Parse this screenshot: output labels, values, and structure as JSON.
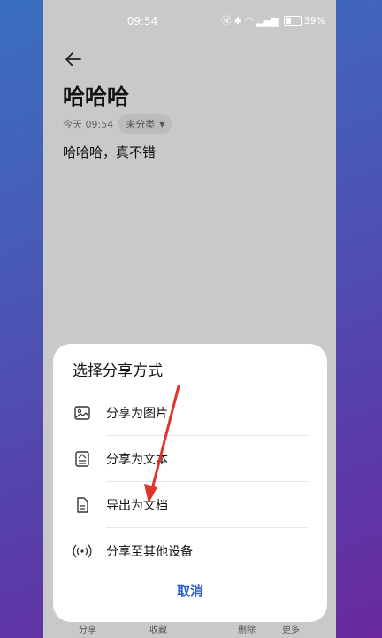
{
  "status_bar": {
    "time": "09:54",
    "battery": "39%"
  },
  "note": {
    "title": "哈哈哈",
    "date": "今天 09:54",
    "category": "未分类",
    "body": "哈哈哈，真不错"
  },
  "toolbar": {
    "items": [
      "分享",
      "收藏",
      "删除",
      "更多"
    ]
  },
  "share_sheet": {
    "title": "选择分享方式",
    "options": [
      {
        "label": "分享为图片",
        "icon": "image-icon"
      },
      {
        "label": "分享为文本",
        "icon": "text-doc-icon"
      },
      {
        "label": "导出为文档",
        "icon": "document-icon"
      },
      {
        "label": "分享至其他设备",
        "icon": "cast-icon"
      }
    ],
    "cancel": "取消"
  },
  "colors": {
    "accent": "#2a5fc9",
    "annotation_arrow": "#e0332b"
  }
}
